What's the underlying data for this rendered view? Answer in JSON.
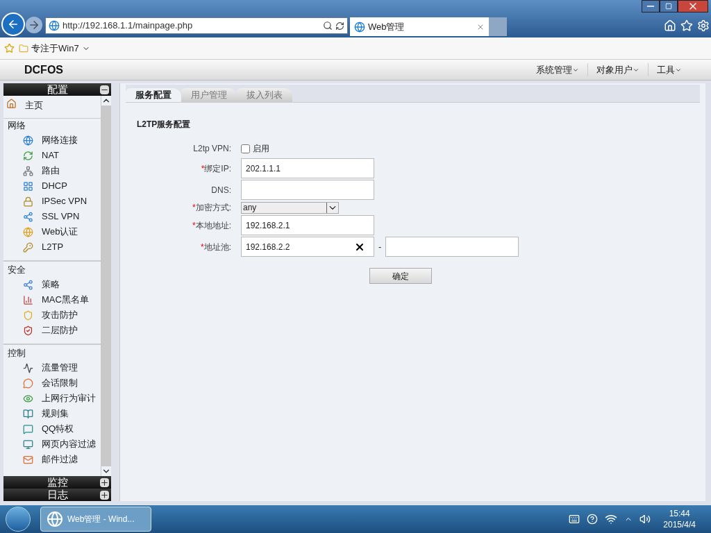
{
  "browser": {
    "url": "http://192.168.1.1/mainpage.php",
    "tab_title": "Web管理",
    "favorites": [
      "专注于Win7"
    ]
  },
  "app": {
    "logo": "DCFOS",
    "menus": [
      "系统管理",
      "对象用户",
      "工具"
    ]
  },
  "sidebar": {
    "panels": [
      {
        "title": "配置",
        "expanded": true
      },
      {
        "title": "监控",
        "expanded": false
      },
      {
        "title": "日志",
        "expanded": false
      }
    ],
    "home": "主页",
    "groups": [
      {
        "title": "网络",
        "items": [
          "网络连接",
          "NAT",
          "路由",
          "DHCP",
          "IPSec VPN",
          "SSL VPN",
          "Web认证",
          "L2TP"
        ]
      },
      {
        "title": "安全",
        "items": [
          "策略",
          "MAC黑名单",
          "攻击防护",
          "二层防护"
        ]
      },
      {
        "title": "控制",
        "items": [
          "流量管理",
          "会话限制",
          "上网行为审计",
          "规则集",
          "QQ特权",
          "网页内容过滤",
          "邮件过滤"
        ]
      }
    ]
  },
  "tabs": [
    {
      "label": "服务配置",
      "selected": true
    },
    {
      "label": "用户管理",
      "selected": false
    },
    {
      "label": "拔入列表",
      "selected": false
    }
  ],
  "form": {
    "title": "L2TP服务配置",
    "fields": [
      {
        "kind": "checkbox",
        "label": "L2tp VPN:",
        "option": "启用",
        "checked": false
      },
      {
        "kind": "text",
        "required_mark": "*",
        "label": "绑定IP:",
        "value": "202.1.1.1"
      },
      {
        "kind": "text",
        "label": "DNS:"
      },
      {
        "kind": "select",
        "required_mark": "*",
        "label": "加密方式:",
        "value": "any"
      },
      {
        "kind": "text",
        "required_mark": "*",
        "label": "本地地址:",
        "value": "192.168.2.1"
      },
      {
        "kind": "range",
        "required_mark": "*",
        "label": "地址池:",
        "value": "192.168.2.2",
        "separator": "-"
      }
    ],
    "submit": "确定"
  },
  "taskbar": {
    "task": "Web管理 - Wind...",
    "time": "15:44",
    "date": "2015/4/4"
  }
}
